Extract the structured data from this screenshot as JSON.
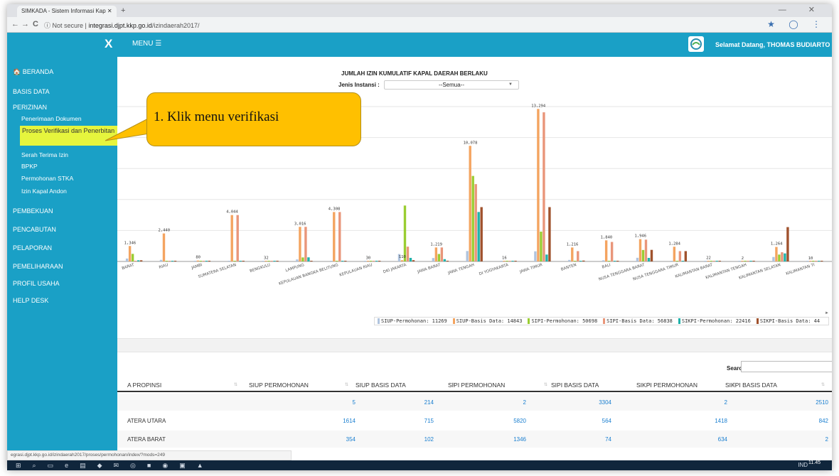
{
  "browser": {
    "tab_title": "SIMKADA - Sistem Informasi Kap",
    "new_tab": "+",
    "window_controls": "— ✕",
    "back": "←",
    "forward": "→",
    "reload": "C",
    "not_secure": "ⓘ Not secure",
    "url_host": "integrasi.djpt.kkp.go.id",
    "url_path": "/izindaerah2017/",
    "star": "★ ◯ ⋮"
  },
  "topbar": {
    "close": "X",
    "menu_label": "MENU ☰",
    "welcome": "Selamat Datang, THOMAS BUDIARTO"
  },
  "sidebar": {
    "beranda": "🏠 BERANDA",
    "basis_data": "BASIS DATA",
    "perizinan": "PERIZINAN",
    "penerimaan": "Penerimaan Dokumen",
    "verifikasi": "Proses Verifikasi dan Penerbitan",
    "serah_terima": "Serah Terima Izin",
    "bpkp": "BPKP",
    "stka": "Permohonan STKA",
    "andon": "Izin Kapal Andon",
    "pembekuan": "PEMBEKUAN",
    "pencabutan": "PENCABUTAN",
    "pelaporan": "PELAPORAN",
    "pemeliharaan": "PEMELIHARAAN",
    "profil": "PROFIL USAHA",
    "helpdesk": "HELP DESK"
  },
  "callout": {
    "text": "1.  Klik menu verifikasi"
  },
  "filter": {
    "title": "JUMLAH IZIN KUMULATIF KAPAL DAERAH BERLAKU",
    "label": "Jenis Instansi :",
    "value": "--Semua--"
  },
  "chart_data": {
    "type": "bar",
    "categories": [
      "BARAT",
      "RIAU",
      "JAMBI",
      "SUMATERA SELATAN",
      "BENGKULU",
      "LAMPUNG",
      "KEPULAUAN BANGKA BELITUNG",
      "KEPULAUAN RIAU",
      "DKI JAKARTA",
      "JAWA BARAT",
      "JAWA TENGAH",
      "DI YOGYAKARTA",
      "JAWA TIMUR",
      "BANTEN",
      "BALI",
      "NUSA TENGGARA BARAT",
      "NUSA TENGGARA TIMUR",
      "KALIMANTAN BARAT",
      "KALIMANTAN TENGAH",
      "KALIMANTAN SELATAN",
      "KALIMANTAN TI"
    ],
    "series": [
      {
        "name": "SIUP-Permohonan: 11269",
        "color": "#b0c4de",
        "values": [
          254,
          137,
          64,
          27,
          35,
          175,
          26,
          25,
          644,
          298,
          908,
          39,
          883,
          133,
          102,
          319,
          31,
          36,
          54,
          388,
          10
        ]
      },
      {
        "name": "SIUP-Basis Data: 14843",
        "color": "#f4a460",
        "values": [
          1346,
          2440,
          80,
          4044,
          32,
          3016,
          4308,
          30,
          110,
          1219,
          10078,
          16,
          13294,
          1216,
          1840,
          1946,
          1284,
          22,
          2,
          1264,
          10
        ]
      },
      {
        "name": "SIPI-Permohonan: 50698",
        "color": "#9acd32",
        "values": [
          660,
          30,
          20,
          10,
          5,
          350,
          10,
          8,
          4874,
          650,
          7454,
          5,
          2600,
          50,
          20,
          1000,
          50,
          10,
          5,
          600,
          5
        ]
      },
      {
        "name": "SIPI-Basis Data: 56838",
        "color": "#e9967a",
        "values": [
          40,
          20,
          10,
          4044,
          3,
          3016,
          4308,
          10,
          1288,
          1219,
          6742,
          3,
          13000,
          900,
          1700,
          1900,
          900,
          10,
          2,
          800,
          5
        ]
      },
      {
        "name": "SIKPI-Permohonan: 22416",
        "color": "#20b2aa",
        "values": [
          100,
          50,
          10,
          5,
          3,
          358,
          5,
          10,
          310,
          200,
          4312,
          2,
          600,
          60,
          40,
          310,
          30,
          5,
          3,
          700,
          5
        ]
      },
      {
        "name": "SIKPI-Basis Data: 44",
        "color": "#a0522d",
        "values": [
          102,
          20,
          5,
          60,
          3,
          40,
          38,
          5,
          110,
          40,
          4736,
          3,
          4736,
          76,
          2,
          1010,
          900,
          5,
          3,
          2994,
          5
        ]
      }
    ],
    "ylim": [
      0,
      13500
    ]
  },
  "table": {
    "search_label": "Search:",
    "headers": [
      "A PROPINSI",
      "SIUP PERMOHONAN",
      "SIUP BASIS DATA",
      "SIPI PERMOHONAN",
      "SIPI BASIS DATA",
      "SIKPI PERMOHONAN",
      "SIKPI BASIS DATA"
    ],
    "rows": [
      {
        "name": "",
        "siup_p": "5",
        "siup_b": "214",
        "sipi_p": "2",
        "sipi_b": "3304",
        "sikpi_p": "2",
        "sikpi_b": "2510"
      },
      {
        "name": "ATERA UTARA",
        "siup_p": "1614",
        "siup_b": "715",
        "sipi_p": "5820",
        "sipi_b": "564",
        "sikpi_p": "1418",
        "sikpi_b": "842"
      },
      {
        "name": "ATERA BARAT",
        "siup_p": "354",
        "siup_b": "102",
        "sipi_p": "1346",
        "sipi_b": "74",
        "sikpi_p": "634",
        "sikpi_b": "2"
      }
    ]
  },
  "status_url": "egrasi.djpt.kkp.go.id/izindaerah2017/proses/permohonan/index/?mods=249",
  "taskbar": {
    "time": "11.45",
    "lang": "IND"
  }
}
